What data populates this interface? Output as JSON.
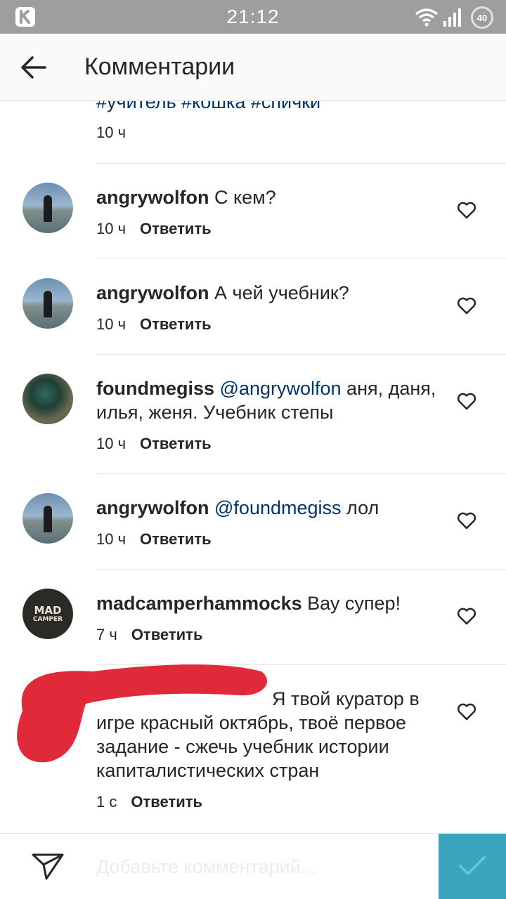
{
  "status_bar": {
    "time": "21:12",
    "battery": "40"
  },
  "header": {
    "title": "Комментарии"
  },
  "caption_tail": {
    "hashtags": "#учитель #кошка #спички",
    "time": "10 ч"
  },
  "comments": [
    {
      "username": "angrywolfon",
      "mention": "",
      "text": "С кем?",
      "time": "10 ч",
      "reply": "Ответить"
    },
    {
      "username": "angrywolfon",
      "mention": "",
      "text": "А чей учебник?",
      "time": "10 ч",
      "reply": "Ответить"
    },
    {
      "username": "foundmegiss",
      "mention": "@angrywolfon",
      "text": "аня, даня, илья, женя. Учебник степы",
      "time": "10 ч",
      "reply": "Ответить"
    },
    {
      "username": "angrywolfon",
      "mention": "@foundmegiss",
      "text": "лол",
      "time": "10 ч",
      "reply": "Ответить"
    },
    {
      "username": "madcamperhammocks",
      "mention": "",
      "text": "Вау супер!",
      "time": "7 ч",
      "reply": "Ответить"
    },
    {
      "username": "",
      "mention": "",
      "text": "Я твой куратор в игре красный октябрь, твоё первое задание - сжечь учебник истории капиталистических стран",
      "time": "1 с",
      "reply": "Ответить"
    }
  ],
  "avatar_logo": {
    "line1": "MAD",
    "line2": "CAMPER"
  },
  "comment_box": {
    "placeholder": "Добавьте комментарий..."
  },
  "colors": {
    "accent": "#3aa6be",
    "mention": "#003569",
    "status_bar": "#9e9e9e",
    "redaction": "#e02a3a"
  },
  "icons": [
    "k-icon",
    "wifi-icon",
    "signal-icon",
    "back-arrow-icon",
    "heart-icon",
    "direct-message-icon",
    "checkmark-icon"
  ]
}
